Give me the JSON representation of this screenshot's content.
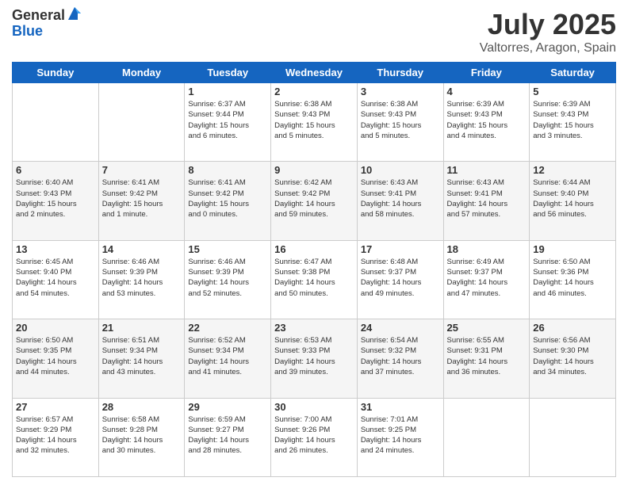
{
  "logo": {
    "general": "General",
    "blue": "Blue"
  },
  "title": {
    "month_year": "July 2025",
    "location": "Valtorres, Aragon, Spain"
  },
  "weekdays": [
    "Sunday",
    "Monday",
    "Tuesday",
    "Wednesday",
    "Thursday",
    "Friday",
    "Saturday"
  ],
  "weeks": [
    [
      {
        "day": "",
        "info": ""
      },
      {
        "day": "",
        "info": ""
      },
      {
        "day": "1",
        "info": "Sunrise: 6:37 AM\nSunset: 9:44 PM\nDaylight: 15 hours\nand 6 minutes."
      },
      {
        "day": "2",
        "info": "Sunrise: 6:38 AM\nSunset: 9:43 PM\nDaylight: 15 hours\nand 5 minutes."
      },
      {
        "day": "3",
        "info": "Sunrise: 6:38 AM\nSunset: 9:43 PM\nDaylight: 15 hours\nand 5 minutes."
      },
      {
        "day": "4",
        "info": "Sunrise: 6:39 AM\nSunset: 9:43 PM\nDaylight: 15 hours\nand 4 minutes."
      },
      {
        "day": "5",
        "info": "Sunrise: 6:39 AM\nSunset: 9:43 PM\nDaylight: 15 hours\nand 3 minutes."
      }
    ],
    [
      {
        "day": "6",
        "info": "Sunrise: 6:40 AM\nSunset: 9:43 PM\nDaylight: 15 hours\nand 2 minutes."
      },
      {
        "day": "7",
        "info": "Sunrise: 6:41 AM\nSunset: 9:42 PM\nDaylight: 15 hours\nand 1 minute."
      },
      {
        "day": "8",
        "info": "Sunrise: 6:41 AM\nSunset: 9:42 PM\nDaylight: 15 hours\nand 0 minutes."
      },
      {
        "day": "9",
        "info": "Sunrise: 6:42 AM\nSunset: 9:42 PM\nDaylight: 14 hours\nand 59 minutes."
      },
      {
        "day": "10",
        "info": "Sunrise: 6:43 AM\nSunset: 9:41 PM\nDaylight: 14 hours\nand 58 minutes."
      },
      {
        "day": "11",
        "info": "Sunrise: 6:43 AM\nSunset: 9:41 PM\nDaylight: 14 hours\nand 57 minutes."
      },
      {
        "day": "12",
        "info": "Sunrise: 6:44 AM\nSunset: 9:40 PM\nDaylight: 14 hours\nand 56 minutes."
      }
    ],
    [
      {
        "day": "13",
        "info": "Sunrise: 6:45 AM\nSunset: 9:40 PM\nDaylight: 14 hours\nand 54 minutes."
      },
      {
        "day": "14",
        "info": "Sunrise: 6:46 AM\nSunset: 9:39 PM\nDaylight: 14 hours\nand 53 minutes."
      },
      {
        "day": "15",
        "info": "Sunrise: 6:46 AM\nSunset: 9:39 PM\nDaylight: 14 hours\nand 52 minutes."
      },
      {
        "day": "16",
        "info": "Sunrise: 6:47 AM\nSunset: 9:38 PM\nDaylight: 14 hours\nand 50 minutes."
      },
      {
        "day": "17",
        "info": "Sunrise: 6:48 AM\nSunset: 9:37 PM\nDaylight: 14 hours\nand 49 minutes."
      },
      {
        "day": "18",
        "info": "Sunrise: 6:49 AM\nSunset: 9:37 PM\nDaylight: 14 hours\nand 47 minutes."
      },
      {
        "day": "19",
        "info": "Sunrise: 6:50 AM\nSunset: 9:36 PM\nDaylight: 14 hours\nand 46 minutes."
      }
    ],
    [
      {
        "day": "20",
        "info": "Sunrise: 6:50 AM\nSunset: 9:35 PM\nDaylight: 14 hours\nand 44 minutes."
      },
      {
        "day": "21",
        "info": "Sunrise: 6:51 AM\nSunset: 9:34 PM\nDaylight: 14 hours\nand 43 minutes."
      },
      {
        "day": "22",
        "info": "Sunrise: 6:52 AM\nSunset: 9:34 PM\nDaylight: 14 hours\nand 41 minutes."
      },
      {
        "day": "23",
        "info": "Sunrise: 6:53 AM\nSunset: 9:33 PM\nDaylight: 14 hours\nand 39 minutes."
      },
      {
        "day": "24",
        "info": "Sunrise: 6:54 AM\nSunset: 9:32 PM\nDaylight: 14 hours\nand 37 minutes."
      },
      {
        "day": "25",
        "info": "Sunrise: 6:55 AM\nSunset: 9:31 PM\nDaylight: 14 hours\nand 36 minutes."
      },
      {
        "day": "26",
        "info": "Sunrise: 6:56 AM\nSunset: 9:30 PM\nDaylight: 14 hours\nand 34 minutes."
      }
    ],
    [
      {
        "day": "27",
        "info": "Sunrise: 6:57 AM\nSunset: 9:29 PM\nDaylight: 14 hours\nand 32 minutes."
      },
      {
        "day": "28",
        "info": "Sunrise: 6:58 AM\nSunset: 9:28 PM\nDaylight: 14 hours\nand 30 minutes."
      },
      {
        "day": "29",
        "info": "Sunrise: 6:59 AM\nSunset: 9:27 PM\nDaylight: 14 hours\nand 28 minutes."
      },
      {
        "day": "30",
        "info": "Sunrise: 7:00 AM\nSunset: 9:26 PM\nDaylight: 14 hours\nand 26 minutes."
      },
      {
        "day": "31",
        "info": "Sunrise: 7:01 AM\nSunset: 9:25 PM\nDaylight: 14 hours\nand 24 minutes."
      },
      {
        "day": "",
        "info": ""
      },
      {
        "day": "",
        "info": ""
      }
    ]
  ]
}
